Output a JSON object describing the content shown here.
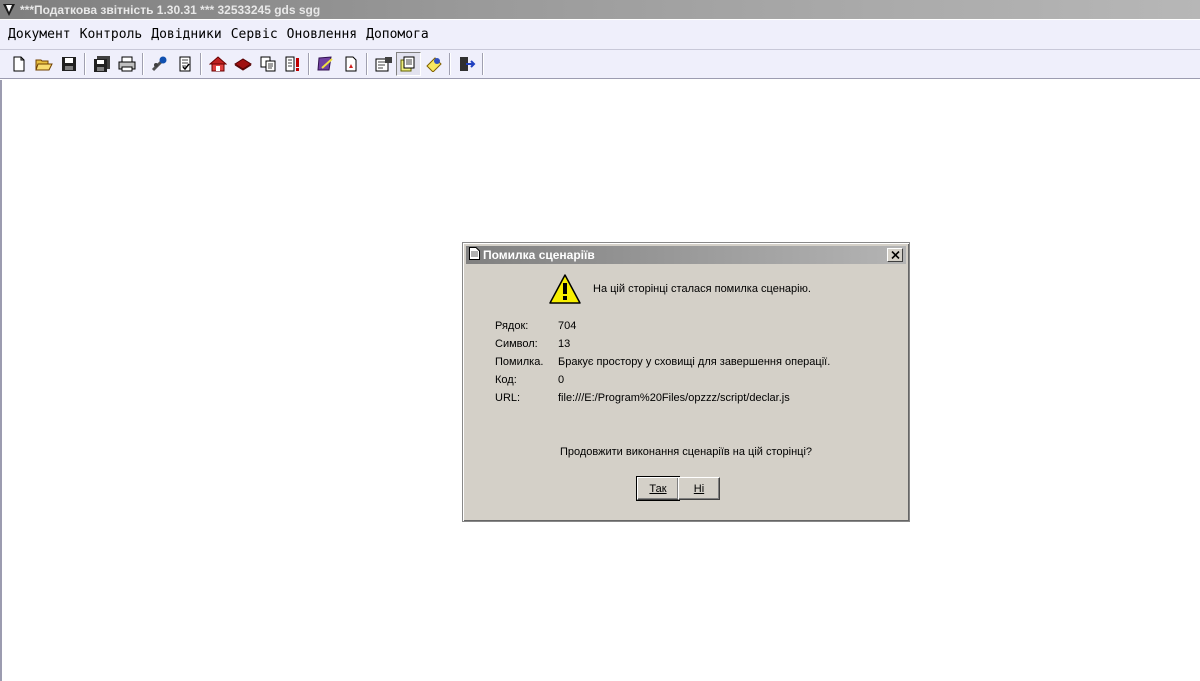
{
  "window": {
    "title": "***Податкова звітність 1.30.31 *** 32533245 gds sgg"
  },
  "menu": [
    {
      "label": "Документ"
    },
    {
      "label": "Контроль"
    },
    {
      "label": "Довідники"
    },
    {
      "label": "Сервіс"
    },
    {
      "label": "Оновлення"
    },
    {
      "label": "Допомога"
    }
  ],
  "toolbar_icons": [
    "new-document-icon",
    "open-folder-icon",
    "save-icon",
    "save-all-icon",
    "print-icon",
    "tools-icon",
    "check-document-icon",
    "home-icon",
    "book-icon",
    "copy-icon",
    "warning-document-icon",
    "edit-document-icon",
    "export-pdf-icon",
    "properties-icon",
    "document-list-icon",
    "update-icon",
    "exit-icon"
  ],
  "dialog": {
    "title": "Помилка сценаріїв",
    "message": "На цій сторінці сталася помилка сценарію.",
    "fields": [
      {
        "label": "Рядок:",
        "value": "704"
      },
      {
        "label": "Символ:",
        "value": "13"
      },
      {
        "label": "Помилка.",
        "value": "Бракує простору у сховищі для завершення операції."
      },
      {
        "label": "Код:",
        "value": "0"
      },
      {
        "label": "URL:",
        "value": "file:///E:/Program%20Files/opzzz/script/declar.js"
      }
    ],
    "question": "Продовжити виконання сценаріїв на цій сторінці?",
    "buttons": {
      "yes": "Так",
      "no": "Ні"
    }
  }
}
